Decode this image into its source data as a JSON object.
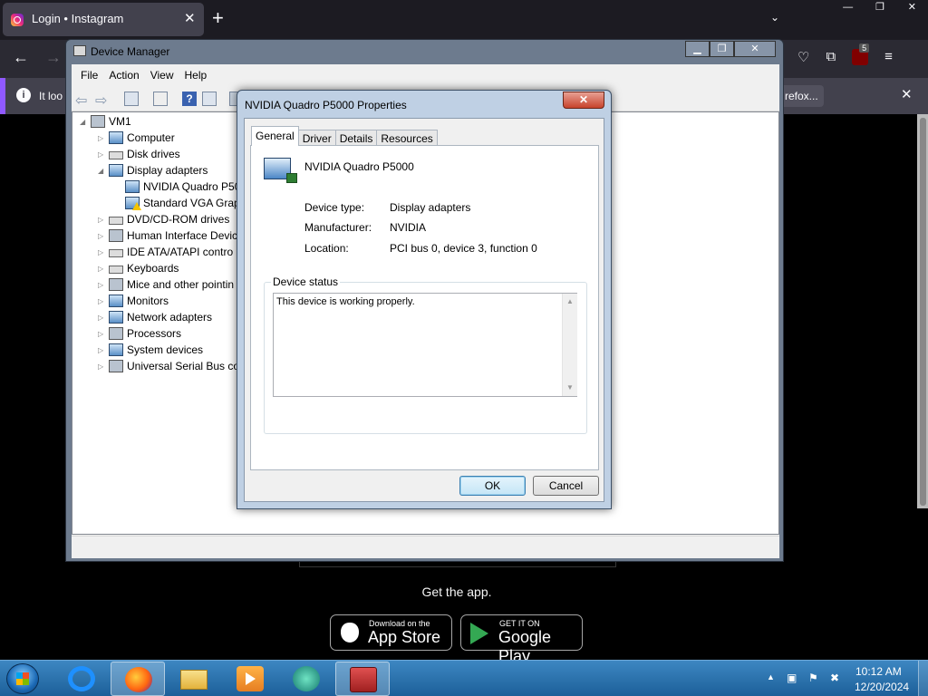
{
  "firefox": {
    "tab_title": "Login • Instagram",
    "tab_close": "✕",
    "new_tab": "+",
    "list_tabs": "⌄",
    "window_controls": [
      "—",
      "❐",
      "✕"
    ],
    "back": "←",
    "forward": "→",
    "ublock_badge": "5",
    "notification_text": "It loo",
    "notification_button": "refox...",
    "notification_close": "✕"
  },
  "instagram": {
    "get_app": "Get the app.",
    "app_store_small": "Download on the",
    "app_store_big": "App Store",
    "google_play_small": "GET IT ON",
    "google_play_big": "Google Play"
  },
  "device_manager": {
    "title": "Device Manager",
    "window_controls": [
      "▁",
      "❐",
      "✕"
    ],
    "menu": [
      "File",
      "Action",
      "View",
      "Help"
    ],
    "tree": {
      "root": "VM1",
      "items": [
        {
          "label": "Computer",
          "icon": "computer-icon",
          "state": "collapsed"
        },
        {
          "label": "Disk drives",
          "icon": "disk-drive-icon",
          "state": "collapsed"
        },
        {
          "label": "Display adapters",
          "icon": "display-adapter-icon",
          "state": "expanded"
        },
        {
          "label": "NVIDIA Quadro P50",
          "icon": "display-adapter-icon",
          "state": "child"
        },
        {
          "label": "Standard VGA Grap",
          "icon": "warning-display-icon",
          "state": "child"
        },
        {
          "label": "DVD/CD-ROM drives",
          "icon": "dvd-drive-icon",
          "state": "collapsed"
        },
        {
          "label": "Human Interface Devic",
          "icon": "hid-icon",
          "state": "collapsed"
        },
        {
          "label": "IDE ATA/ATAPI contro",
          "icon": "ide-controller-icon",
          "state": "collapsed"
        },
        {
          "label": "Keyboards",
          "icon": "keyboard-icon",
          "state": "collapsed"
        },
        {
          "label": "Mice and other pointin",
          "icon": "mouse-icon",
          "state": "collapsed"
        },
        {
          "label": "Monitors",
          "icon": "monitor-icon",
          "state": "collapsed"
        },
        {
          "label": "Network adapters",
          "icon": "network-adapter-icon",
          "state": "collapsed"
        },
        {
          "label": "Processors",
          "icon": "processor-icon",
          "state": "collapsed"
        },
        {
          "label": "System devices",
          "icon": "system-devices-icon",
          "state": "collapsed"
        },
        {
          "label": "Universal Serial Bus co",
          "icon": "usb-icon",
          "state": "collapsed"
        }
      ]
    }
  },
  "properties": {
    "title": "NVIDIA Quadro P5000 Properties",
    "close": "✕",
    "tabs": [
      "General",
      "Driver",
      "Details",
      "Resources"
    ],
    "active_tab": "General",
    "device_name": "NVIDIA Quadro P5000",
    "fields": [
      {
        "label": "Device type:",
        "value": "Display adapters"
      },
      {
        "label": "Manufacturer:",
        "value": "NVIDIA"
      },
      {
        "label": "Location:",
        "value": "PCI bus 0, device 3, function 0"
      }
    ],
    "status_group_label": "Device status",
    "status_text": "This device is working properly.",
    "ok": "OK",
    "cancel": "Cancel"
  },
  "taskbar": {
    "apps": [
      "internet-explorer-icon",
      "firefox-icon",
      "file-explorer-icon",
      "media-player-icon",
      "teamviewer-icon",
      "device-manager-icon"
    ],
    "active_app": "device-manager-icon",
    "clock_time": "10:12 AM",
    "clock_date": "12/20/2024",
    "tray_arrow": "▲"
  }
}
